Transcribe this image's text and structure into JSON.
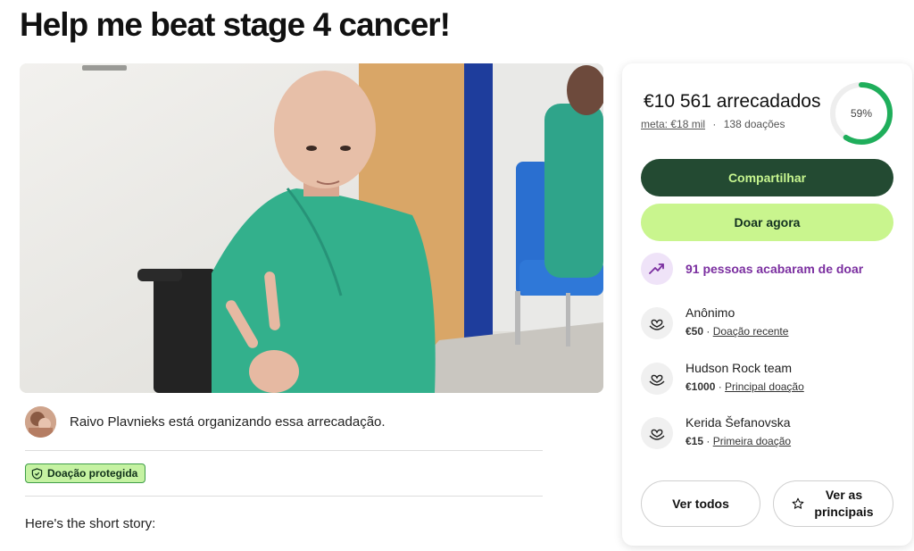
{
  "page": {
    "title": "Help me beat stage 4 cancer!"
  },
  "organizer": {
    "text": "Raivo Plavnieks está organizando essa arrecadação."
  },
  "badge": {
    "label": "Doação protegida"
  },
  "story": {
    "intro": "Here's the short story:"
  },
  "donation_card": {
    "raised": "€10 561 arrecadados",
    "goal": "meta: €18 mil",
    "separator": "·",
    "count": "138 doações",
    "progress_percent": 59,
    "progress_label": "59%",
    "share_label": "Compartilhar",
    "donate_label": "Doar agora",
    "recent_activity": "91 pessoas acabaram de doar",
    "donors": [
      {
        "name": "Anônimo",
        "amount": "€50",
        "sep": " · ",
        "tag": "Doação recente"
      },
      {
        "name": "Hudson Rock team",
        "amount": "€1000",
        "sep": " · ",
        "tag": "Principal doação"
      },
      {
        "name": "Kerida Šefanovska",
        "amount": "€15",
        "sep": " · ",
        "tag": "Primeira doação"
      }
    ],
    "see_all_label": "Ver todos",
    "see_top_label": "Ver as principais"
  },
  "colors": {
    "brand_dark": "#234a32",
    "brand_light": "#c9f58e",
    "progress": "#1fae5b",
    "activity": "#7b2fa0"
  },
  "icons": [
    "shield-icon",
    "trending-up-icon",
    "heart-hand-icon",
    "star-icon"
  ]
}
